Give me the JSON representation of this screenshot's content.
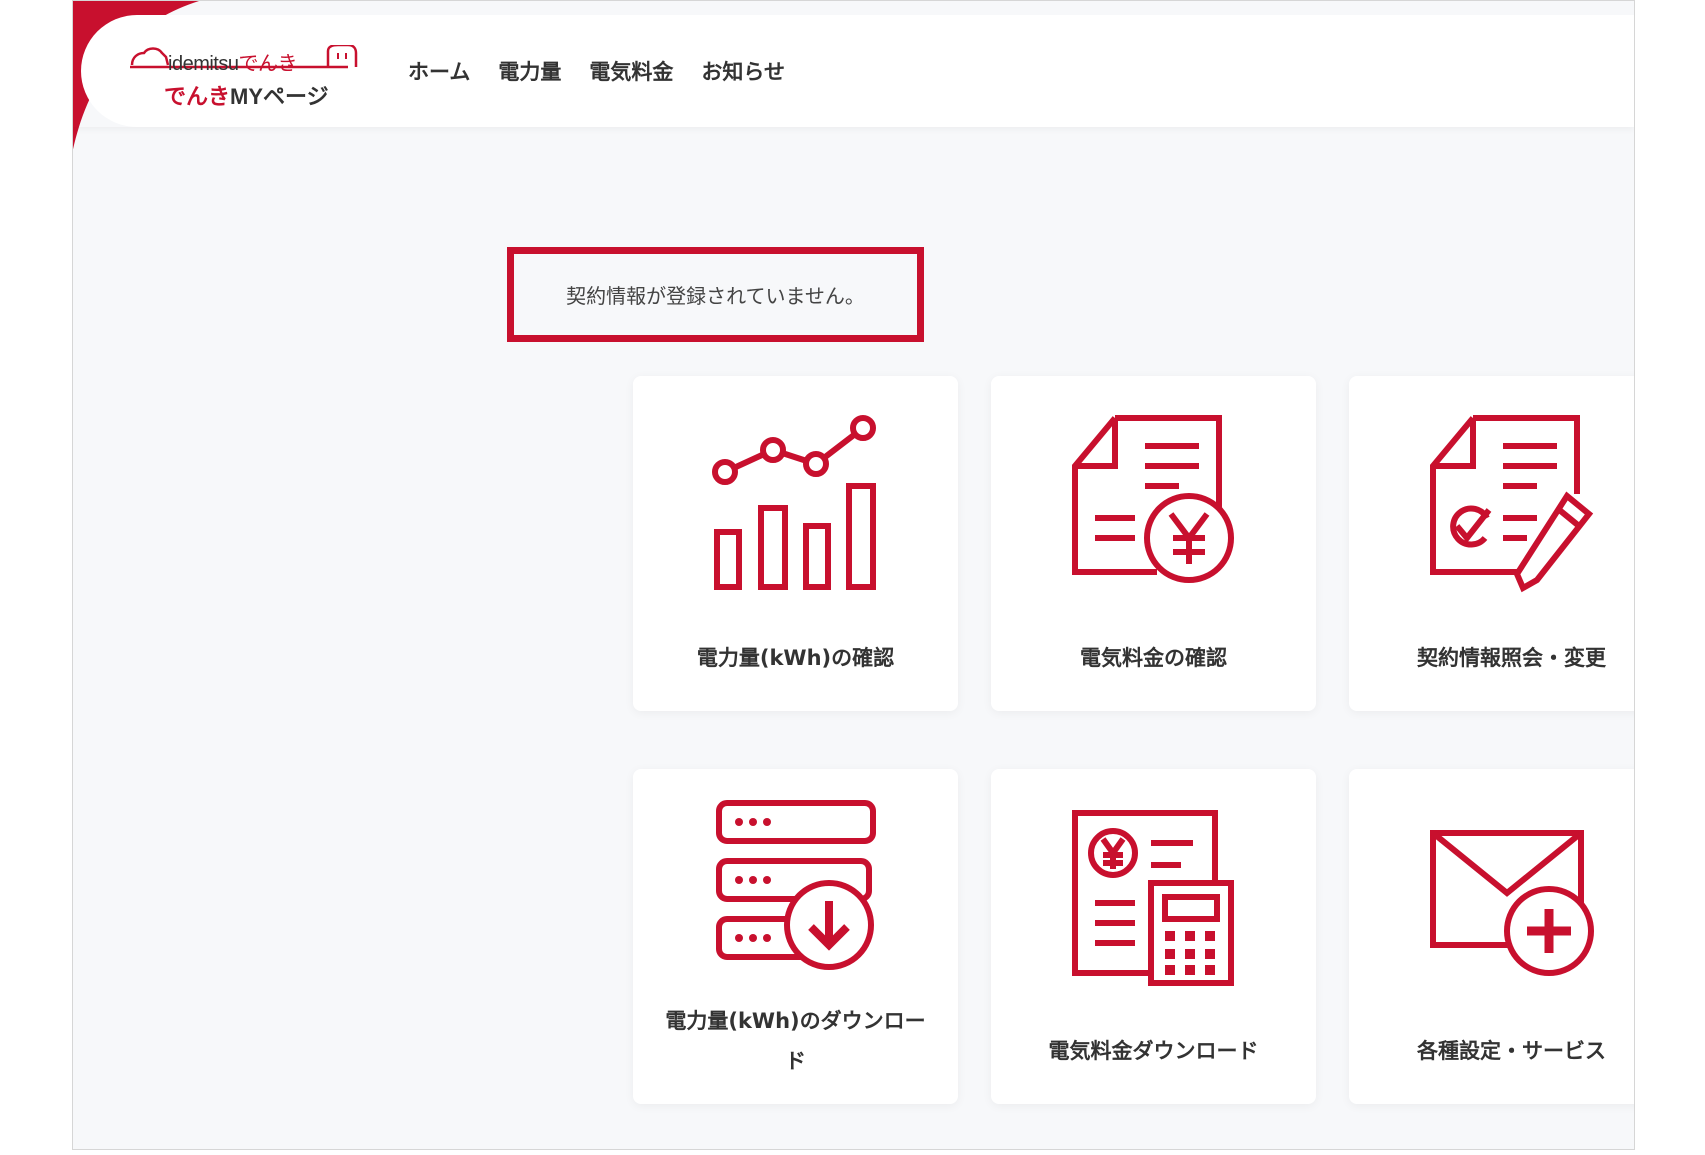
{
  "header": {
    "logo": {
      "brand_top_latin": "idemitsu",
      "brand_top_jp": "でんき",
      "brand_bottom_red": "でんき",
      "brand_bottom_dark": "MYページ"
    },
    "nav": [
      {
        "label": "ホーム"
      },
      {
        "label": "電力量"
      },
      {
        "label": "電気料金"
      },
      {
        "label": "お知らせ"
      }
    ]
  },
  "notice": {
    "text": "契約情報が登録されていません。"
  },
  "menu": [
    {
      "label": "電力量(kWh)の確認",
      "icon": "usage-chart-icon"
    },
    {
      "label": "電気料金の確認",
      "icon": "bill-yen-icon"
    },
    {
      "label": "契約情報照会・変更",
      "icon": "contract-edit-icon"
    },
    {
      "label": "電力量(kWh)のダウンロード",
      "icon": "usage-download-icon"
    },
    {
      "label": "電気料金ダウンロード",
      "icon": "bill-calculator-icon"
    },
    {
      "label": "各種設定・サービス",
      "icon": "mail-add-icon"
    }
  ],
  "colors": {
    "accent": "#c8102e",
    "background": "#f7f8fa",
    "text": "#333333"
  }
}
